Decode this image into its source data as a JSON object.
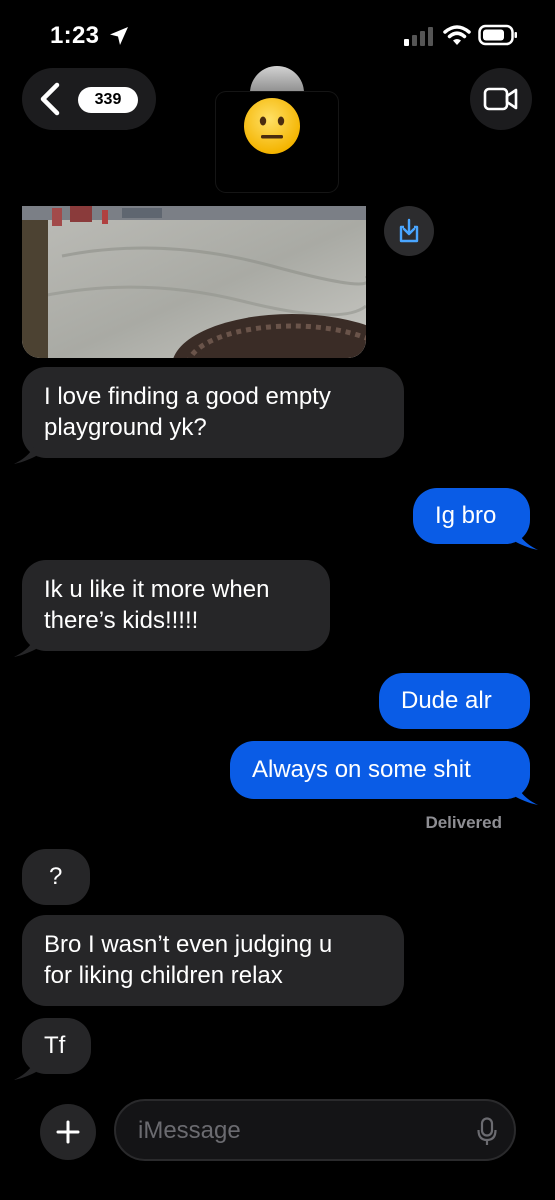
{
  "status_bar": {
    "time": "1:23",
    "icons": [
      "location-arrow-icon",
      "cellular-signal-icon",
      "wifi-icon",
      "battery-icon"
    ]
  },
  "header": {
    "back_icon": "chevron-left-icon",
    "unread_count": "339",
    "contact_emoji": "😐",
    "video_icon": "video-camera-icon"
  },
  "colors": {
    "background": "#000000",
    "incoming_bubble": "#262628",
    "outgoing_bubble": "#0a5ce6",
    "meta_text": "#8e8e93"
  },
  "messages": [
    {
      "direction": "incoming",
      "type": "image",
      "save_icon": "save-download-icon"
    },
    {
      "direction": "incoming",
      "lines": [
        "I love finding a good empty",
        "playground yk?"
      ]
    },
    {
      "direction": "outgoing",
      "lines": [
        "Ig bro"
      ]
    },
    {
      "direction": "incoming",
      "lines": [
        "Ik u like it more when",
        "there’s kids!!!!!"
      ]
    },
    {
      "direction": "outgoing",
      "lines": [
        "Dude alr"
      ]
    },
    {
      "direction": "outgoing",
      "lines": [
        "Always on some shit"
      ]
    },
    {
      "direction": "incoming",
      "lines": [
        "?"
      ]
    },
    {
      "direction": "incoming",
      "lines": [
        "Bro I wasn’t even judging u",
        "for liking children relax"
      ]
    },
    {
      "direction": "incoming",
      "lines": [
        "Tf"
      ]
    }
  ],
  "delivery_status": "Delivered",
  "composer": {
    "placeholder": "iMessage",
    "value": "",
    "plus_icon": "plus-icon",
    "mic_icon": "microphone-icon"
  }
}
